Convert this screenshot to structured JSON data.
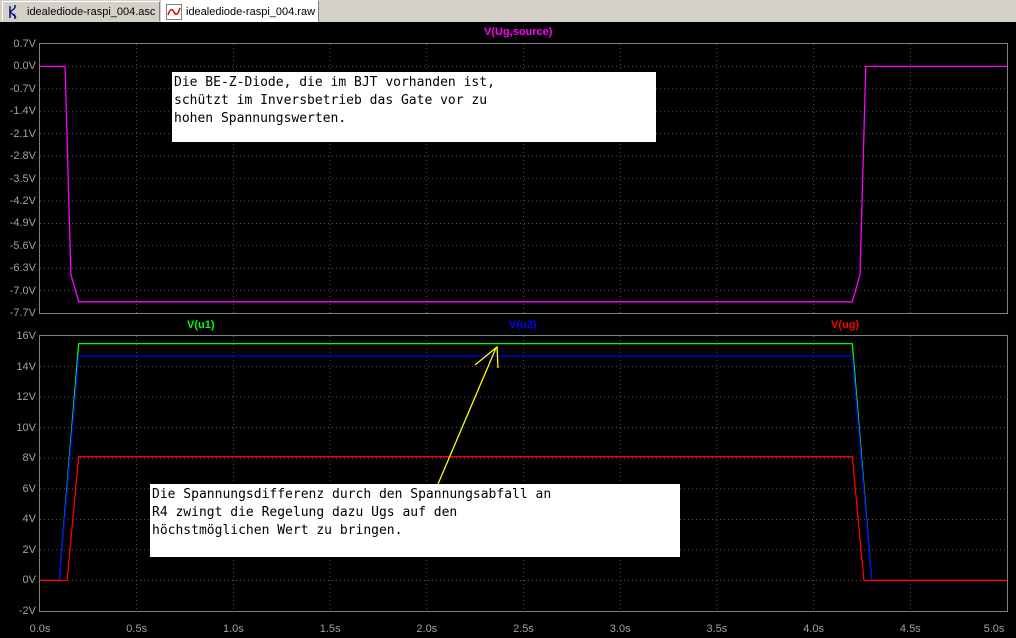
{
  "tabs": [
    {
      "label": "idealediode-raspi_004.asc",
      "icon": "schematic-icon"
    },
    {
      "label": "idealediode-raspi_004.raw",
      "icon": "waveform-icon"
    }
  ],
  "top_pane": {
    "trace_label": "V(Ug,source)",
    "y_ticks": [
      "0.7V",
      "0.0V",
      "-0.7V",
      "-1.4V",
      "-2.1V",
      "-2.8V",
      "-3.5V",
      "-4.2V",
      "-4.9V",
      "-5.6V",
      "-6.3V",
      "-7.0V",
      "-7.7V"
    ],
    "annotation": "Die BE-Z-Diode, die im BJT vorhanden ist,\nschützt im Inversbetrieb das Gate vor zu\nhohen Spannungswerten."
  },
  "bottom_pane": {
    "trace_labels": [
      "V(u1)",
      "V(u2)",
      "V(ug)"
    ],
    "y_ticks": [
      "16V",
      "14V",
      "12V",
      "10V",
      "8V",
      "6V",
      "4V",
      "2V",
      "0V",
      "-2V"
    ],
    "annotation": "Die Spannungsdifferenz durch den Spannungsabfall an\nR4 zwingt die Regelung dazu Ugs auf den\nhöchstmöglichen Wert zu bringen."
  },
  "x_ticks": [
    "0.0s",
    "0.5s",
    "1.0s",
    "1.5s",
    "2.0s",
    "2.5s",
    "3.0s",
    "3.5s",
    "4.0s",
    "4.5s",
    "5.0s"
  ],
  "colors": {
    "ug_source": "#ff00ff",
    "u1": "#00ff00",
    "u2": "#0000ff",
    "ug": "#ff0000",
    "arrow": "#ffff00",
    "grid": "#808080"
  },
  "chart_data": [
    {
      "type": "line",
      "title": "V(Ug,source)",
      "xlim": [
        0,
        5.0
      ],
      "ylim": [
        -7.7,
        0.7
      ],
      "series": [
        {
          "name": "V(Ug,source)",
          "x": [
            0.0,
            0.13,
            0.16,
            0.2,
            4.2,
            4.24,
            4.27,
            4.3,
            5.0
          ],
          "y": [
            0.0,
            0.0,
            -6.5,
            -7.35,
            -7.35,
            -6.5,
            0.0,
            0.0,
            0.0
          ]
        }
      ]
    },
    {
      "type": "line",
      "xlim": [
        0,
        5.0
      ],
      "ylim": [
        -2,
        16
      ],
      "series": [
        {
          "name": "V(u1)",
          "x": [
            0.0,
            0.1,
            0.2,
            4.2,
            4.3,
            5.0
          ],
          "y": [
            0.0,
            0.0,
            15.5,
            15.5,
            0.0,
            0.0
          ]
        },
        {
          "name": "V(u2)",
          "x": [
            0.0,
            0.1,
            0.2,
            4.2,
            4.3,
            5.0
          ],
          "y": [
            0.0,
            0.0,
            14.7,
            14.7,
            0.0,
            0.0
          ]
        },
        {
          "name": "V(ug)",
          "x": [
            0.0,
            0.14,
            0.2,
            4.2,
            4.26,
            5.0
          ],
          "y": [
            0.0,
            0.0,
            8.1,
            8.1,
            0.0,
            0.0
          ]
        }
      ]
    }
  ]
}
